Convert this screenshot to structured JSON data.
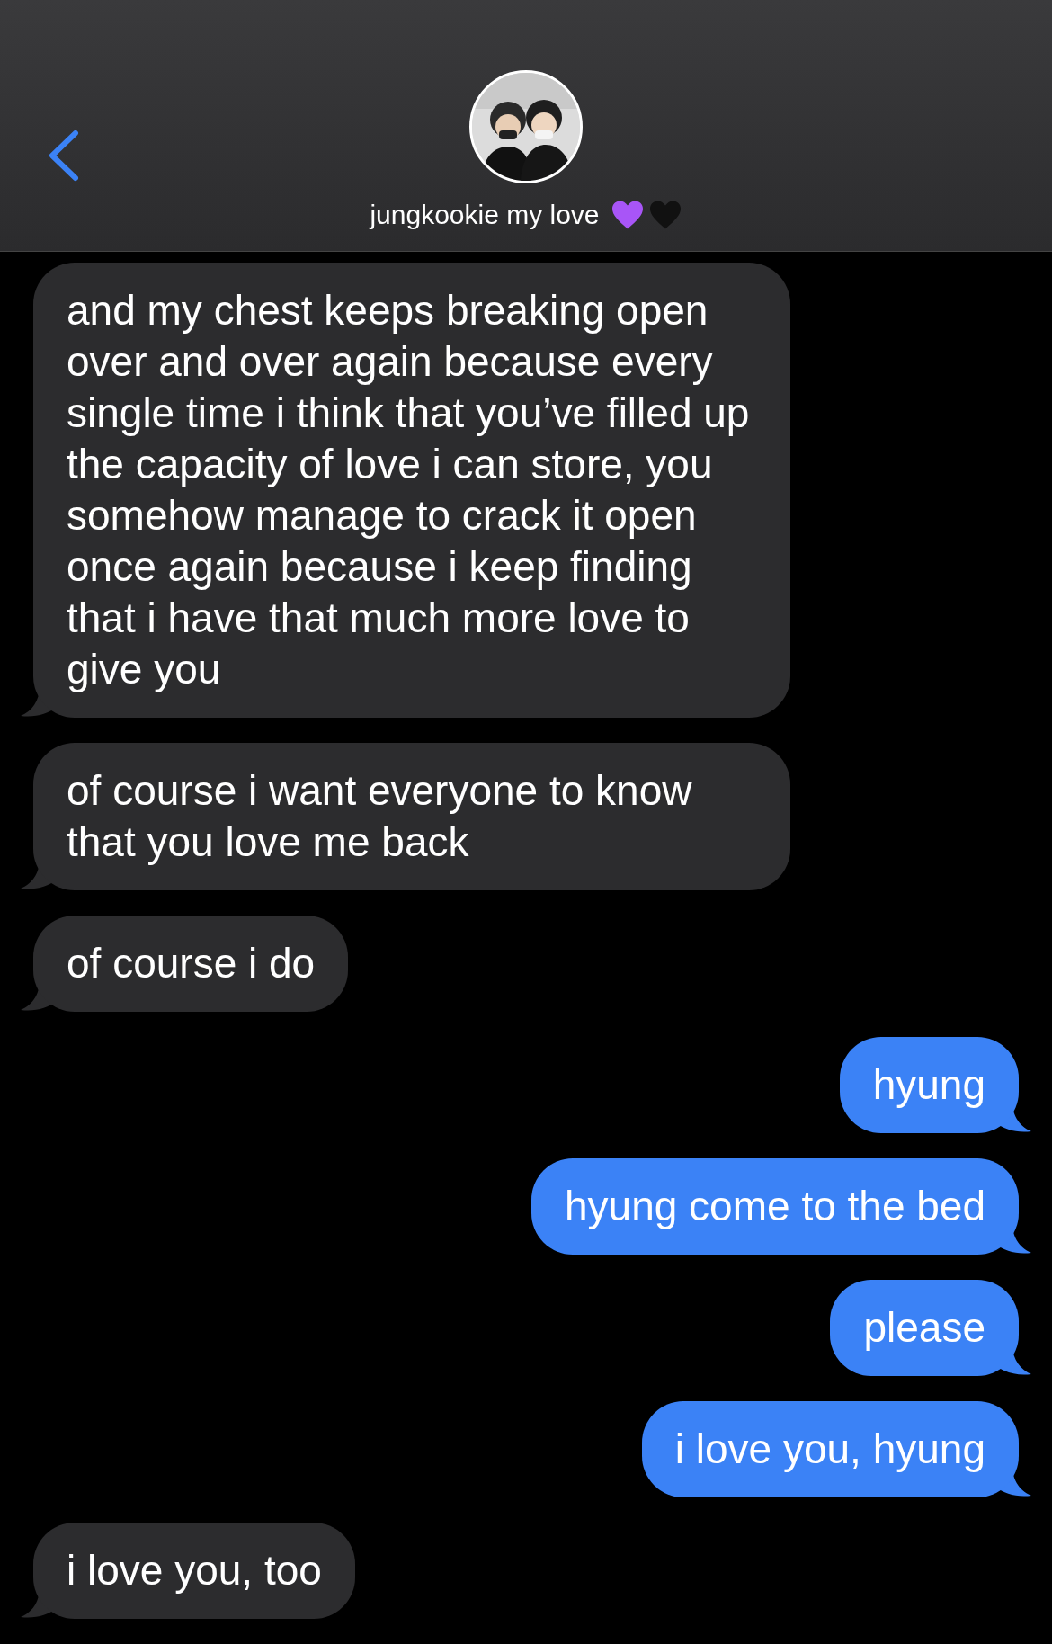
{
  "header": {
    "contact_name": "jungkookie my love"
  },
  "messages": [
    {
      "kind": "incoming",
      "text": "and my chest keeps breaking open over and over again because every single time i think that you’ve filled up the capacity of love i can store, you somehow manage to crack it open once again because i keep finding that i have that much more love to give you"
    },
    {
      "kind": "incoming",
      "text": "of course i want everyone to know that you love me back"
    },
    {
      "kind": "incoming",
      "text": "of course i do"
    },
    {
      "kind": "outgoing",
      "text": "hyung"
    },
    {
      "kind": "outgoing",
      "text": "hyung come to the bed"
    },
    {
      "kind": "outgoing",
      "text": "please"
    },
    {
      "kind": "outgoing",
      "text": "i love you, hyung"
    },
    {
      "kind": "incoming",
      "text": "i love you, too"
    }
  ]
}
